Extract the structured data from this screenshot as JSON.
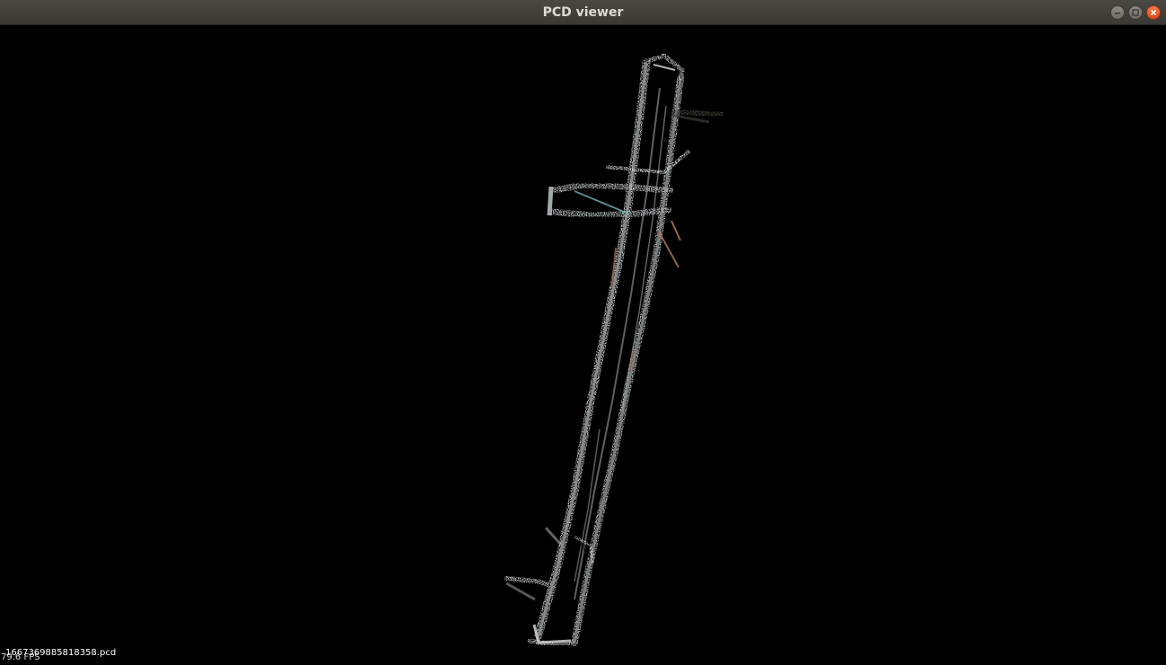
{
  "window": {
    "title": "PCD viewer",
    "minimize_icon": "minimize-icon",
    "maximize_icon": "maximize-icon",
    "close_icon": "close-icon",
    "close_color": "#e95420"
  },
  "viewer": {
    "background_color": "#000000",
    "fps_text": "79.6 FPS",
    "filename_text": "1667369885818358.pcd"
  }
}
